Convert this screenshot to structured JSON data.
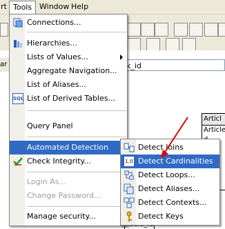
{
  "menubar": {
    "items": [
      {
        "label": "rt"
      },
      {
        "label": "Tools"
      },
      {
        "label": "Window"
      },
      {
        "label": "Help"
      }
    ]
  },
  "background": {
    "field_text": "k_id",
    "left_fragment": "ar",
    "table_header": "Articl",
    "table_row1": "Article_",
    "table_rows": [
      "d",
      "l",
      "l",
      "l",
      "l",
      "l"
    ],
    "bottom_fragment": "rticle_id"
  },
  "tools_menu": {
    "items": [
      {
        "label": "Connections...",
        "icon": "connections-icon"
      },
      {
        "label": "Hierarchies...",
        "icon": "hierarchies-icon"
      },
      {
        "label": "Lists of Values...",
        "icon": "",
        "submenu": true
      },
      {
        "label": "Aggregate Navigation...",
        "icon": ""
      },
      {
        "label": "List of Aliases...",
        "icon": ""
      },
      {
        "label": "List of Derived Tables...",
        "icon": "sql-icon"
      },
      {
        "label": "Query Panel",
        "icon": ""
      },
      {
        "label": "Automated Detection",
        "icon": "",
        "submenu": true
      },
      {
        "label": "Check Integrity...",
        "icon": "check-integrity-icon"
      },
      {
        "label": "Login As...",
        "icon": "",
        "disabled": true
      },
      {
        "label": "Change Password...",
        "icon": "",
        "disabled": true
      },
      {
        "label": "Manage security...",
        "icon": "",
        "submenu": true
      }
    ],
    "sql_icon_text": "SQL"
  },
  "detection_submenu": {
    "items": [
      {
        "label": "Detect Joins",
        "icon": "detect-joins-icon"
      },
      {
        "label": "Detect Cardinalities",
        "icon": "detect-cardinalities-icon"
      },
      {
        "label": "Detect Loops...",
        "icon": "detect-loops-icon"
      },
      {
        "label": "Detect Aliases...",
        "icon": "detect-aliases-icon"
      },
      {
        "label": "Detect Contexts...",
        "icon": "detect-contexts-icon"
      },
      {
        "label": "Detect Keys",
        "icon": "detect-keys-icon"
      }
    ],
    "cardinality_icon_text": "1,0"
  },
  "colors": {
    "highlight": "#316ac5",
    "annotation_arrow": "#e00000",
    "disabled_text": "#9d9d9d"
  }
}
